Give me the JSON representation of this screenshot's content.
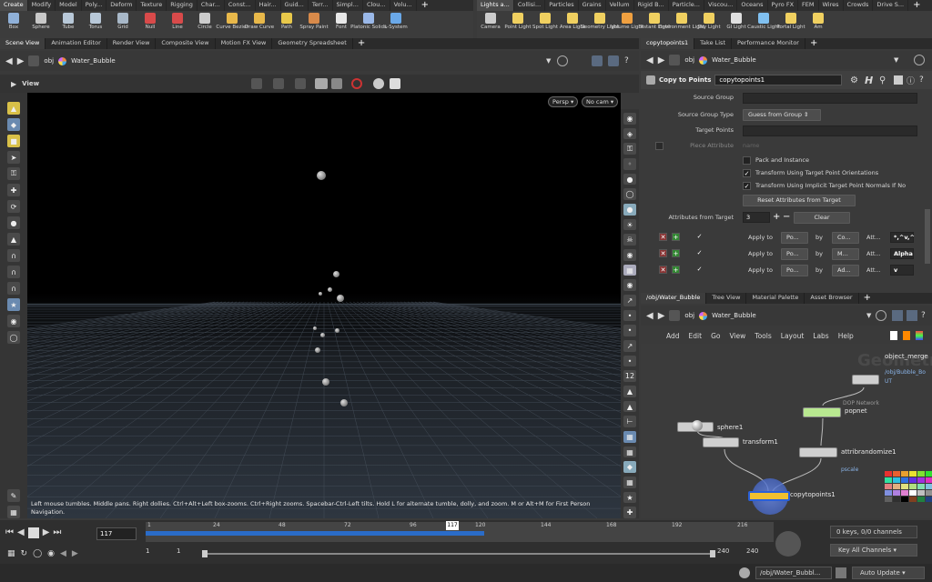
{
  "shelf_left": {
    "tabs": [
      "Create",
      "Modify",
      "Model",
      "Poly...",
      "Deform",
      "Texture",
      "Rigging",
      "Char...",
      "Const...",
      "Hair...",
      "Guid...",
      "Terr...",
      "Simpl...",
      "Clou...",
      "Volu..."
    ],
    "tools": [
      {
        "label": "Box",
        "color": "#8fb0d8",
        "icon": "box-icon"
      },
      {
        "label": "Sphere",
        "color": "#c8c8c8",
        "icon": "sphere-icon"
      },
      {
        "label": "Tube",
        "color": "#b8c8d8",
        "icon": "tube-icon"
      },
      {
        "label": "Torus",
        "color": "#b8c8d8",
        "icon": "torus-icon"
      },
      {
        "label": "Grid",
        "color": "#a8b8c8",
        "icon": "grid-icon"
      },
      {
        "label": "Null",
        "color": "#d84a4a",
        "icon": "null-icon"
      },
      {
        "label": "Line",
        "color": "#d84a4a",
        "icon": "line-icon"
      },
      {
        "label": "Circle",
        "color": "#cccccc",
        "icon": "circle-icon"
      },
      {
        "label": "Curve Bezier",
        "color": "#e8b84a",
        "icon": "curve-bezier-icon"
      },
      {
        "label": "Draw Curve",
        "color": "#e8b84a",
        "icon": "draw-curve-icon"
      },
      {
        "label": "Path",
        "color": "#e8c84a",
        "icon": "path-icon"
      },
      {
        "label": "Spray Paint",
        "color": "#d88a4a",
        "icon": "spray-paint-icon"
      },
      {
        "label": "Font",
        "color": "#e8e8e8",
        "icon": "font-icon"
      },
      {
        "label": "Platonic Solids",
        "color": "#9ab8e8",
        "icon": "platonic-solids-icon"
      },
      {
        "label": "L-System",
        "color": "#6aa8e8",
        "icon": "l-system-icon"
      }
    ]
  },
  "shelf_right": {
    "tabs": [
      "Lights a...",
      "Collisi...",
      "Particles",
      "Grains",
      "Vellum",
      "Rigid B...",
      "Particle...",
      "Viscou...",
      "Oceans",
      "Pyro FX",
      "FEM",
      "Wires",
      "Crowds",
      "Drive S..."
    ],
    "tools": [
      {
        "label": "Camera",
        "color": "#cccccc",
        "icon": "camera-icon"
      },
      {
        "label": "Point Light",
        "color": "#f0d060",
        "icon": "point-light-icon"
      },
      {
        "label": "Spot Light",
        "color": "#f0d060",
        "icon": "spot-light-icon"
      },
      {
        "label": "Area Light",
        "color": "#f0d060",
        "icon": "area-light-icon"
      },
      {
        "label": "Geometry Light",
        "color": "#f0d060",
        "icon": "geometry-light-icon"
      },
      {
        "label": "Volume Light",
        "color": "#f0a040",
        "icon": "volume-light-icon"
      },
      {
        "label": "Distant Light",
        "color": "#f0d060",
        "icon": "distant-light-icon"
      },
      {
        "label": "Environment Light",
        "color": "#f0d060",
        "icon": "environment-light-icon"
      },
      {
        "label": "Sky Light",
        "color": "#f0d060",
        "icon": "sky-light-icon"
      },
      {
        "label": "GI Light",
        "color": "#e0e0e0",
        "icon": "gi-light-icon"
      },
      {
        "label": "Caustic Light",
        "color": "#80c0f0",
        "icon": "caustic-light-icon"
      },
      {
        "label": "Portal Light",
        "color": "#f0d060",
        "icon": "portal-light-icon"
      },
      {
        "label": "Am",
        "color": "#f0d060",
        "icon": "ambient-light-icon"
      }
    ]
  },
  "left_pane": {
    "tabs": [
      "Scene View",
      "Animation Editor",
      "Render View",
      "Composite View",
      "Motion FX View",
      "Geometry Spreadsheet"
    ],
    "path": [
      "obj",
      "Water_Bubble"
    ],
    "view_label": "View",
    "cam_persp": "Persp",
    "cam_nocam": "No cam",
    "hud_message": "Left mouse tumbles. Middle pans. Right dollies. Ctrl+Alt+Left box-zooms. Ctrl+Right zooms. Spacebar-Ctrl-Left tilts. Hold L for alternate tumble, dolly, and zoom.    M or Alt+M for First Person Navigation."
  },
  "param_pane": {
    "tabs": [
      "copytopoints1",
      "Take List",
      "Performance Monitor"
    ],
    "path": [
      "obj",
      "Water_Bubble"
    ],
    "node_type": "Copy to Points",
    "node_name": "copytopoints1",
    "source_group_label": "Source Group",
    "source_group_type_label": "Source Group Type",
    "source_group_type_value": "Guess from Group",
    "target_points_label": "Target Points",
    "piece_attribute_label": "Piece Attribute",
    "piece_attribute_placeholder": "name",
    "pack_instance": "Pack and Instance",
    "transform_orient": "Transform Using Target Point Orientations",
    "transform_normals": "Transform Using Implicit Target Point Normals If No",
    "reset_attrs": "Reset Attributes from Target",
    "attrs_from_target_label": "Attributes from Target",
    "attrs_from_target_value": "3",
    "clear_label": "Clear",
    "apply_rows": [
      {
        "apply_to": "Apply to",
        "target": "Po...",
        "by": "by",
        "method": "Co...",
        "att": "Att...",
        "value": "*,^v,^"
      },
      {
        "apply_to": "Apply to",
        "target": "Po...",
        "by": "by",
        "method": "M...",
        "att": "Att...",
        "value": "Alpha"
      },
      {
        "apply_to": "Apply to",
        "target": "Po...",
        "by": "by",
        "method": "Ad...",
        "att": "Att...",
        "value": "v"
      }
    ]
  },
  "net_pane": {
    "tabs": [
      "/obj/Water_Bubble",
      "Tree View",
      "Material Palette",
      "Asset Browser"
    ],
    "path": [
      "obj",
      "Water_Bubble"
    ],
    "menu": [
      "Add",
      "Edit",
      "Go",
      "View",
      "Tools",
      "Layout",
      "Labs",
      "Help"
    ],
    "watermark": "Geometry",
    "nodes": {
      "object_merge": {
        "name": "object_merge",
        "sub": "/obj/Bubble_Bo",
        "sub2": "UT"
      },
      "sphere": {
        "name": "sphere1"
      },
      "transform": {
        "name": "transform1"
      },
      "popnet": {
        "name": "popnet",
        "type": "DOP Network"
      },
      "attribrandomize": {
        "name": "attribrandomize1",
        "sub": "pscale"
      },
      "copytopoints": {
        "name": "copytopoints1"
      }
    }
  },
  "timeline": {
    "current_frame": "117",
    "playhead_label": "117",
    "ticks": [
      "1",
      "24",
      "48",
      "72",
      "96",
      "120",
      "144",
      "168",
      "192",
      "216"
    ],
    "range_start": "1",
    "range_start2": "1",
    "range_end": "240",
    "range_end2": "240",
    "keys_label": "0 keys, 0/0 channels",
    "key_all_channels": "Key All Channels"
  },
  "status": {
    "path": "/obj/Water_Bubbl...",
    "update_mode": "Auto Update"
  },
  "palette_colors": [
    "#e83030",
    "#e86030",
    "#e8a030",
    "#e8e030",
    "#80e030",
    "#30e030",
    "#30e0a0",
    "#30c0e0",
    "#3070e0",
    "#6030e0",
    "#a030e0",
    "#e030c0",
    "#e08080",
    "#e0b080",
    "#e0e080",
    "#b0e080",
    "#80e0b0",
    "#80c0e0",
    "#8090e0",
    "#b080e0",
    "#e080d0",
    "#ffffff",
    "#c0c0c0",
    "#909090",
    "#606060",
    "#303030",
    "#000000",
    "#804020",
    "#208040",
    "#204080"
  ]
}
